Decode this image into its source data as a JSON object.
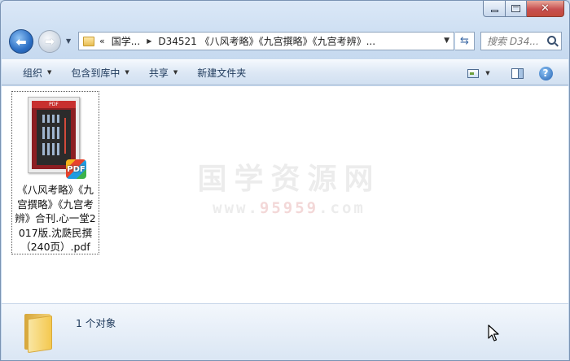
{
  "address": {
    "chevron": "«",
    "segments": [
      "国学...",
      "D34521 《八风考略》《九宫撰略》《九宫考辨》..."
    ]
  },
  "search": {
    "placeholder": "搜索 D34..."
  },
  "toolbar": {
    "organize": "组织",
    "include_library": "包含到库中",
    "share": "共享",
    "new_folder": "新建文件夹"
  },
  "file": {
    "name": "《八风考略》《九宫撰略》《九宫考辨》合刊.心一堂2017版.沈瓞民撰（240页）.pdf",
    "badge": "PDF",
    "thumb_header": "PDF"
  },
  "watermark": {
    "title": "国学资源网",
    "url_prefix": "www.",
    "url_highlight": "95959",
    "url_suffix": ".com"
  },
  "status": {
    "count_text": "1 个对象"
  },
  "colors": {
    "accent": "#1e395b",
    "window_frame": "#c9dbee",
    "close": "#c75050"
  }
}
